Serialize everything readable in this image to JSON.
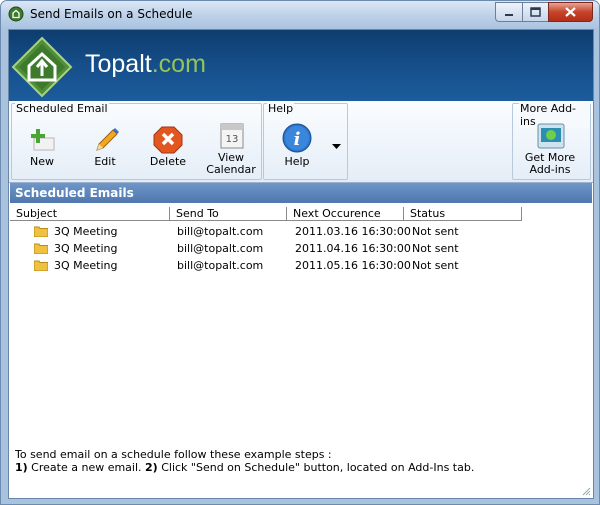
{
  "window": {
    "title": "Send Emails on a Schedule",
    "controls": [
      "minimize",
      "maximize",
      "close"
    ]
  },
  "banner": {
    "brand_main": "Topalt",
    "brand_tld": ".com",
    "logo_icon": "house-arrow-icon"
  },
  "ribbon": {
    "groups": [
      {
        "label": "Scheduled Email",
        "buttons": [
          {
            "label": "New",
            "icon": "new-plus-icon"
          },
          {
            "label": "Edit",
            "icon": "pencil-icon"
          },
          {
            "label": "Delete",
            "icon": "delete-x-icon"
          },
          {
            "label_line1": "View",
            "label_line2": "Calendar",
            "icon": "calendar-icon"
          }
        ]
      },
      {
        "label": "Help",
        "buttons": [
          {
            "label": "Help",
            "icon": "info-icon",
            "dropdown": "chevron-down-icon"
          }
        ]
      },
      {
        "label": "More Add-ins",
        "buttons": [
          {
            "label_line1": "Get More",
            "label_line2": "Add-ins",
            "icon": "addins-icon"
          }
        ]
      }
    ]
  },
  "list": {
    "section_title": "Scheduled Emails",
    "columns": [
      "Subject",
      "Send To",
      "Next Occurence",
      "Status"
    ],
    "rows": [
      {
        "subject": "3Q Meeting",
        "send_to": "bill@topalt.com",
        "next": "2011.03.16 16:30:00",
        "status": "Not sent"
      },
      {
        "subject": "3Q Meeting",
        "send_to": "bill@topalt.com",
        "next": "2011.04.16 16:30:00",
        "status": "Not sent"
      },
      {
        "subject": "3Q Meeting",
        "send_to": "bill@topalt.com",
        "next": "2011.05.16 16:30:00",
        "status": "Not sent"
      }
    ]
  },
  "footer": {
    "intro": "To send email on a schedule follow these example steps :",
    "step1_num": "1)",
    "step1_text": " Create a new email. ",
    "step2_num": "2)",
    "step2_text": " Click \"Send on Schedule\" button, located on Add-Ins tab."
  },
  "colors": {
    "banner": "#16508c",
    "brand_accent": "#93c35a",
    "section_header": "#5a82b8",
    "close_button": "#c7432a"
  }
}
